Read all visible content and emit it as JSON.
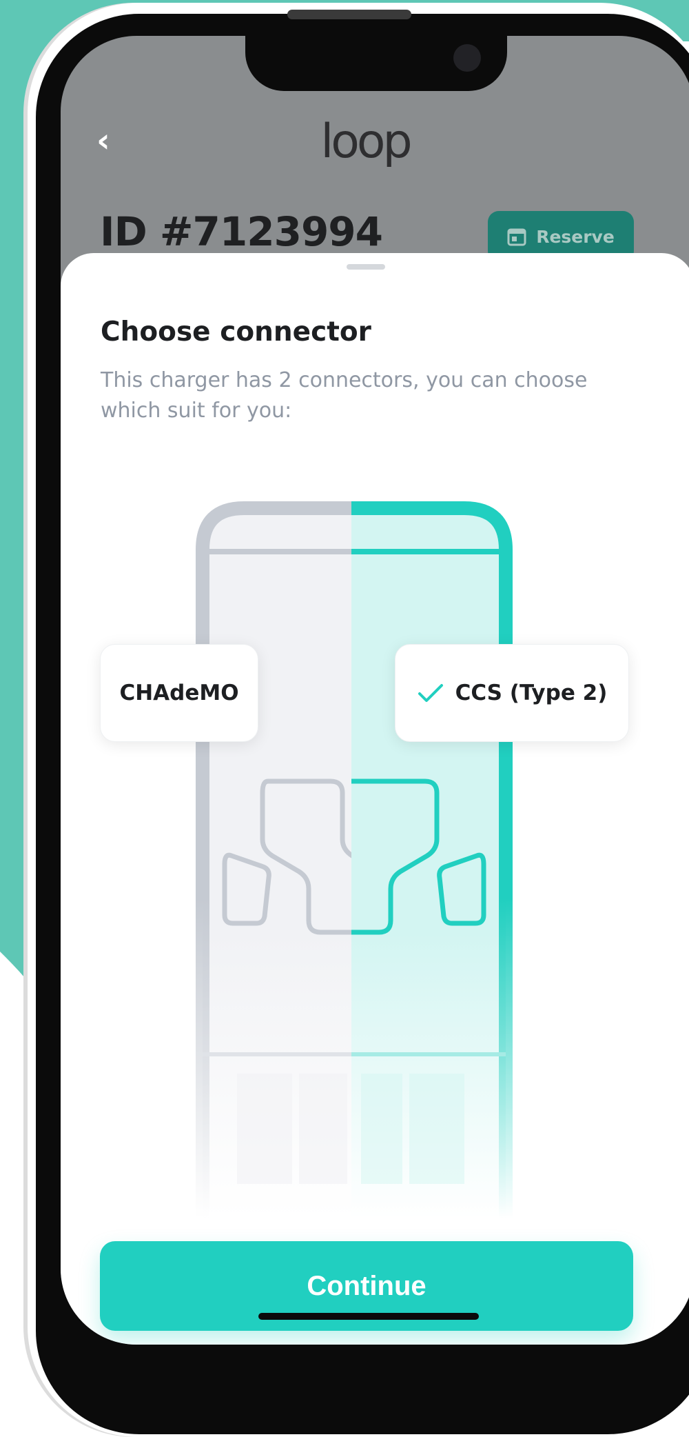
{
  "header": {
    "back_glyph": "‹",
    "logo_text": "loop",
    "charger_id": "ID #7123994",
    "reserve_label": "Reserve"
  },
  "sheet": {
    "title": "Choose connector",
    "subtitle": "This charger has 2 connectors, you can choose which suit for you:",
    "connectors": [
      {
        "label": "CHAdeMO",
        "selected": false
      },
      {
        "label": "CCS (Type 2)",
        "selected": true
      }
    ],
    "continue_label": "Continue"
  },
  "colors": {
    "accent": "#21CFC0",
    "accent_dark": "#1E7F73",
    "background_teal": "#5EC7B5",
    "overlay_gray": "#8A8D8F",
    "text_primary": "#1D1F22",
    "text_secondary": "#8F97A3",
    "illustration_gray": "#C5CAD2"
  },
  "icons": {
    "back": "chevron-left-icon",
    "reserve": "calendar-icon",
    "selected": "check-icon"
  }
}
